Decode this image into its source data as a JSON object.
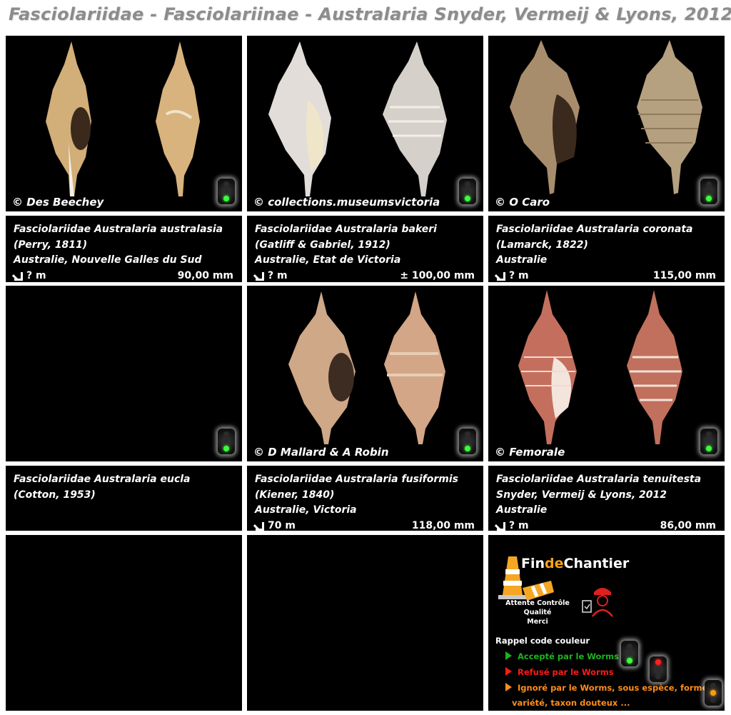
{
  "page": {
    "title": "Fasciolariidae - Fasciolariinae - Australaria Snyder, Vermeij & Lyons, 2012"
  },
  "species": [
    {
      "credit": "© Des Beechey",
      "name": "Fasciolariidae Australaria australasia",
      "author": "(Perry, 1811)",
      "locality": "Australie, Nouvelle Galles du Sud",
      "depth": "? m",
      "size": "90,00 mm",
      "status": "green",
      "shell_color": "#c9a46c"
    },
    {
      "credit": "© collections.museumsvictoria",
      "name": "Fasciolariidae Australaria bakeri",
      "author": "(Gatliff & Gabriel, 1912)",
      "locality": "Australie, Etat de Victoria",
      "depth": "? m",
      "size": "± 100,00 mm",
      "status": "green",
      "shell_color": "#d9d4d0"
    },
    {
      "credit": "© O Caro",
      "name": "Fasciolariidae Australaria coronata",
      "author": "(Lamarck, 1822)",
      "locality": "Australie",
      "depth": "? m",
      "size": "115,00 mm",
      "status": "green",
      "shell_color": "#a38b6c"
    },
    {
      "credit": "",
      "name": "Fasciolariidae Australaria  eucla",
      "author": "(Cotton, 1953)",
      "locality": "",
      "depth": "",
      "size": "",
      "status": "green",
      "shell_color": ""
    },
    {
      "credit": "© D Mallard & A Robin",
      "name": "Fasciolariidae Australaria fusiformis",
      "author": "(Kiener, 1840)",
      "locality": "Australie, Victoria",
      "depth": "70 m",
      "size": "118,00 mm",
      "status": "green",
      "shell_color": "#cda584"
    },
    {
      "credit": "© Femorale",
      "name": "Fasciolariidae Australaria tenuitesta",
      "author": "Snyder, Vermeij & Lyons, 2012",
      "locality": "Australie",
      "depth": "? m",
      "size": "86,00 mm",
      "status": "green",
      "shell_color": "#c26a58"
    }
  ],
  "logo": {
    "brand_part1": "Fin",
    "brand_part2": "de",
    "brand_part3": "Chantier",
    "subtitle_line1": "Attente Contrôle Qualité",
    "subtitle_line2": "Merci"
  },
  "legend": {
    "title": "Rappel code couleur",
    "accepted": "Accepté par le Worms",
    "refused": "Refusé par le Worms",
    "ignored_line1": "Ignoré par le Worms, sous espèce, forme",
    "ignored_line2": "variété, taxon douteux ...",
    "colors": {
      "accepted": "#1db31d",
      "refused": "#ff1a1a",
      "ignored": "#ff8c1a"
    }
  }
}
